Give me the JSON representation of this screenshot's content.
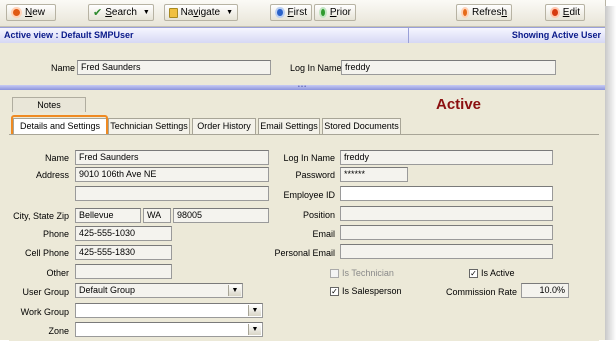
{
  "toolbar": {
    "new": {
      "prefix": "",
      "accel": "N",
      "suffix": "ew"
    },
    "search": {
      "prefix": "",
      "accel": "S",
      "suffix": "earch"
    },
    "navigate": {
      "prefix": "Na",
      "accel": "v",
      "suffix": "igate"
    },
    "first": {
      "prefix": "",
      "accel": "F",
      "suffix": "irst"
    },
    "prior": {
      "prefix": "",
      "accel": "P",
      "suffix": "rior"
    },
    "refresh": {
      "prefix": "Refres",
      "accel": "h",
      "suffix": ""
    },
    "edit": {
      "prefix": "",
      "accel": "E",
      "suffix": "dit"
    }
  },
  "viewbar": {
    "left": "Active view : Default SMPUser",
    "right": "Showing Active User"
  },
  "header": {
    "name_label": "Name",
    "name_value": "Fred Saunders",
    "login_label": "Log In Name",
    "login_value": "freddy"
  },
  "notes_tab": "Notes",
  "status_title": "Active",
  "tabs": [
    "Details and Settings",
    "Technician Settings",
    "Order History",
    "Email Settings",
    "Stored Documents"
  ],
  "form": {
    "name_label": "Name",
    "name": "Fred Saunders",
    "address_label": "Address",
    "address1": "9010 106th Ave NE",
    "address2": "",
    "csz_label": "City, State Zip",
    "city": "Bellevue",
    "state": "WA",
    "zip": "98005",
    "phone_label": "Phone",
    "phone": "425-555-1030",
    "cell_label": "Cell Phone",
    "cell": "425-555-1830",
    "other_label": "Other",
    "other": "",
    "usergroup_label": "User Group",
    "usergroup": "Default Group",
    "workgroup_label": "Work Group",
    "workgroup": "",
    "zone_label": "Zone",
    "login_label": "Log In Name",
    "login": "freddy",
    "password_label": "Password",
    "password": "******",
    "empid_label": "Employee ID",
    "empid": "",
    "position_label": "Position",
    "position": "",
    "email_label": "Email",
    "email": "",
    "pemail_label": "Personal Email",
    "pemail": "",
    "is_technician_label": "Is Technician",
    "is_technician": false,
    "is_active_label": "Is Active",
    "is_active": true,
    "is_salesperson_label": "Is Salesperson",
    "is_salesperson": true,
    "commission_label": "Commission Rate",
    "commission": "10.0%"
  },
  "icons": {
    "check": "✓",
    "dropdown": "▼",
    "splitter": "• • •"
  }
}
